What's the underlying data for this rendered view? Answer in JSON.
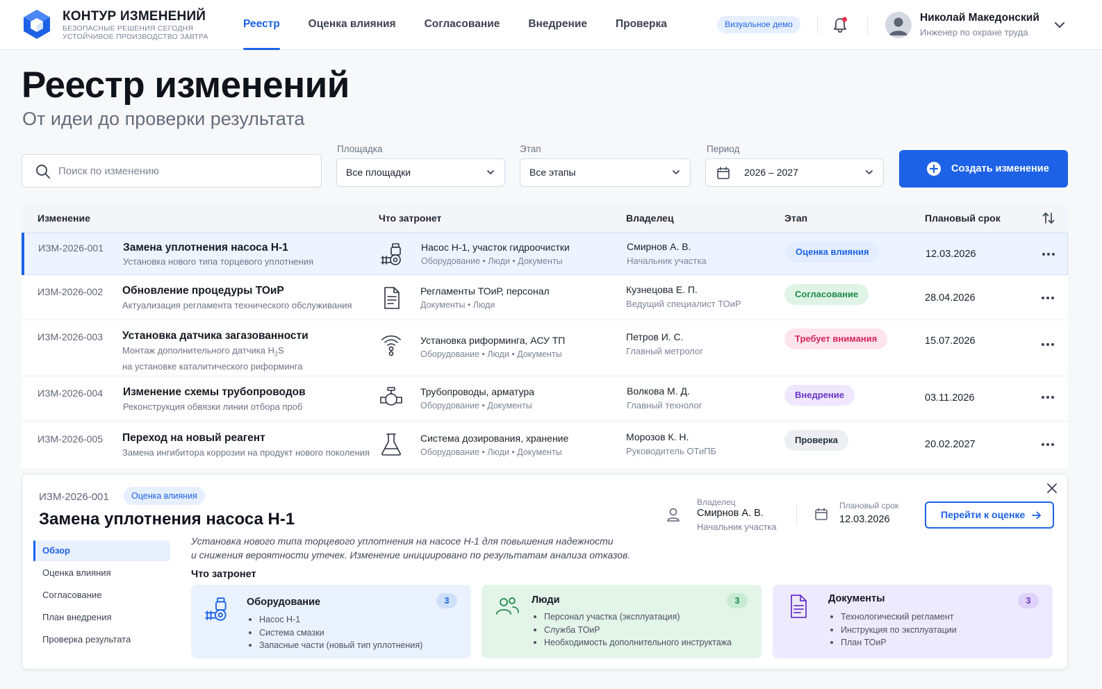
{
  "brand": {
    "name": "КОНТУР ИЗМЕНЕНИЙ",
    "tagline_1": "БЕЗОПАСНЫЕ РЕШЕНИЯ СЕГОДНЯ",
    "tagline_2": "УСТОЙЧИВОЕ ПРОИЗВОДСТВО ЗАВТРА"
  },
  "nav": {
    "items": [
      {
        "label": "Реестр",
        "active": true
      },
      {
        "label": "Оценка влияния"
      },
      {
        "label": "Согласование"
      },
      {
        "label": "Внедрение"
      },
      {
        "label": "Проверка"
      }
    ]
  },
  "header": {
    "demo_badge": "Визуальное демо",
    "user_name": "Николай Македонский",
    "user_role": "Инженер по охране труда"
  },
  "page": {
    "title": "Реестр изменений",
    "subtitle": "От идеи до проверки результата"
  },
  "filters": {
    "search_placeholder": "Поиск по изменению",
    "site_label": "Площадка",
    "site_value": "Все площадки",
    "stage_label": "Этап",
    "stage_value": "Все этапы",
    "period_label": "Период",
    "period_value": "2026 – 2027",
    "create_label": "Создать изменение"
  },
  "table": {
    "headers": {
      "change": "Изменение",
      "affects": "Что затронет",
      "owner": "Владелец",
      "stage": "Этап",
      "due": "Плановый срок"
    },
    "rows": [
      {
        "id": "ИЗМ-2026-001",
        "title": "Замена уплотнения насоса Н-1",
        "desc": "Установка нового типа торцевого уплотнения",
        "icon": "pump-icon",
        "affects": "Насос Н-1, участок гидроочистки",
        "tags": "Оборудование • Люди • Документы",
        "owner": "Смирнов А. В.",
        "owner_role": "Начальник участка",
        "stage": "Оценка влияния",
        "date": "12.03.2026"
      },
      {
        "id": "ИЗМ-2026-002",
        "title": "Обновление процедуры ТОиР",
        "desc": "Актуализация регламента технического обслуживания",
        "icon": "document-icon",
        "affects": "Регламенты ТОиР, персонал",
        "tags": "Документы • Люди",
        "owner": "Кузнецова Е. П.",
        "owner_role": "Ведущий специалист ТОиР",
        "stage": "Согласование",
        "date": "28.04.2026"
      },
      {
        "id": "ИЗМ-2026-003",
        "title": "Установка датчика загазованности",
        "desc_1": "Монтаж дополнительного датчика H",
        "desc_sub": "2",
        "desc_2": "S",
        "desc_3": "на установке каталитического риформинга",
        "icon": "sensor-icon",
        "affects": "Установка риформинга, АСУ ТП",
        "tags": "Оборудование • Люди • Документы",
        "owner": "Петров И. С.",
        "owner_role": "Главный метролог",
        "stage": "Требует внимания",
        "date": "15.07.2026"
      },
      {
        "id": "ИЗМ-2026-004",
        "title": "Изменение схемы трубопроводов",
        "desc": "Реконструкция обвязки линии отбора проб",
        "icon": "valve-icon",
        "affects": "Трубопроводы, арматура",
        "tags": "Оборудование • Документы",
        "owner": "Волкова М. Д.",
        "owner_role": "Главный технолог",
        "stage": "Внедрение",
        "date": "03.11.2026"
      },
      {
        "id": "ИЗМ-2026-005",
        "title": "Переход на новый реагент",
        "desc": "Замена ингибитора коррозии на продукт нового поколения",
        "icon": "flask-icon",
        "affects": "Система дозирования, хранение",
        "tags": "Оборудование • Люди • Документы",
        "owner": "Морозов К. Н.",
        "owner_role": "Руководитель ОТиПБ",
        "stage": "Проверка",
        "date": "20.02.2027"
      }
    ]
  },
  "detail": {
    "id": "ИЗМ-2026-001",
    "badge": "Оценка влияния",
    "title": "Замена уплотнения насоса Н-1",
    "owner_label": "Владелец",
    "owner_name": "Смирнов А. В.",
    "owner_role": "Начальник участка",
    "due_label": "Плановый срок",
    "due_value": "12.03.2026",
    "go_button": "Перейти к оценке",
    "side_tabs": [
      "Обзор",
      "Оценка влияния",
      "Согласование",
      "План внедрения",
      "Проверка результата"
    ],
    "desc_1": "Установка нового типа торцевого уплотнения на насосе Н-1 для повышения надежности",
    "desc_2": "и снижения вероятности утечек. Изменение инициировано по результатам анализа отказов.",
    "affects_title": "Что затронет",
    "cards": [
      {
        "title": "Оборудование",
        "count": "3",
        "items": [
          "Насос Н-1",
          "Система смазки",
          "Запасные части (новый тип уплотнения)"
        ]
      },
      {
        "title": "Люди",
        "count": "3",
        "items": [
          "Персонал участка (эксплуатация)",
          "Служба ТОиР",
          "Необходимость дополнительного инструктажа"
        ]
      },
      {
        "title": "Документы",
        "count": "3",
        "items": [
          "Технологический регламент",
          "Инструкция по эксплуатации",
          "План ТОиР"
        ]
      }
    ]
  },
  "colors": {
    "accent": "#1d62e6",
    "stage_impact": "#e3edff",
    "stage_approval": "#dff4e6",
    "stage_attention": "#fde4ec",
    "stage_implementation": "#efe7fe",
    "stage_check": "#eceef2"
  }
}
